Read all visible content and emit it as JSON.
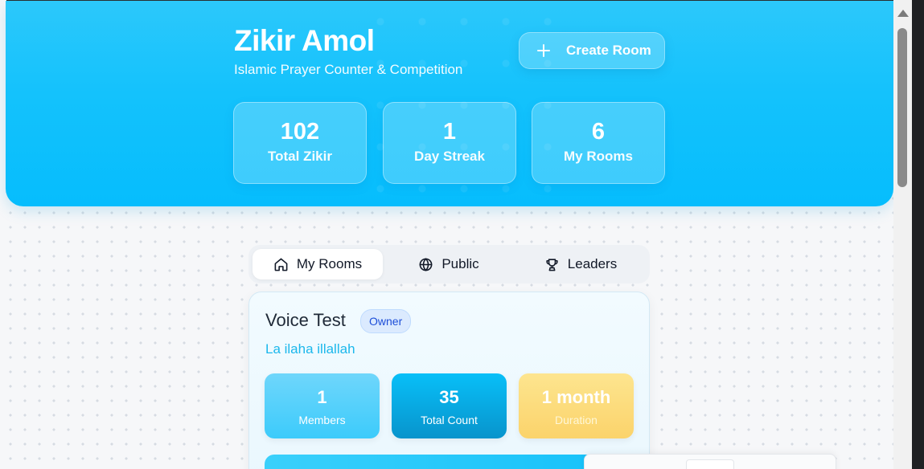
{
  "header": {
    "title": "Zikir Amol",
    "subtitle": "Islamic Prayer Counter & Competition",
    "create_button": {
      "icon": "plus-icon",
      "label": "Create Room"
    },
    "stats": [
      {
        "value": "102",
        "label": "Total Zikir"
      },
      {
        "value": "1",
        "label": "Day Streak"
      },
      {
        "value": "6",
        "label": "My Rooms"
      }
    ]
  },
  "tabs": [
    {
      "icon": "home-icon",
      "label": "My Rooms",
      "active": true
    },
    {
      "icon": "globe-icon",
      "label": "Public",
      "active": false
    },
    {
      "icon": "trophy-icon",
      "label": "Leaders",
      "active": false
    }
  ],
  "room": {
    "name": "Voice Test",
    "badge": "Owner",
    "dhikr": "La ilaha illallah",
    "stats": [
      {
        "value": "1",
        "label": "Members"
      },
      {
        "value": "35",
        "label": "Total Count"
      },
      {
        "value": "1 month",
        "label": "Duration"
      }
    ]
  },
  "colors": {
    "header_gradient_start": "#2cc8fb",
    "header_gradient_end": "#06bdfd",
    "accent": "#1cb8ec",
    "badge_text": "#1d4ed8",
    "duration_card": "#fbd36b"
  }
}
